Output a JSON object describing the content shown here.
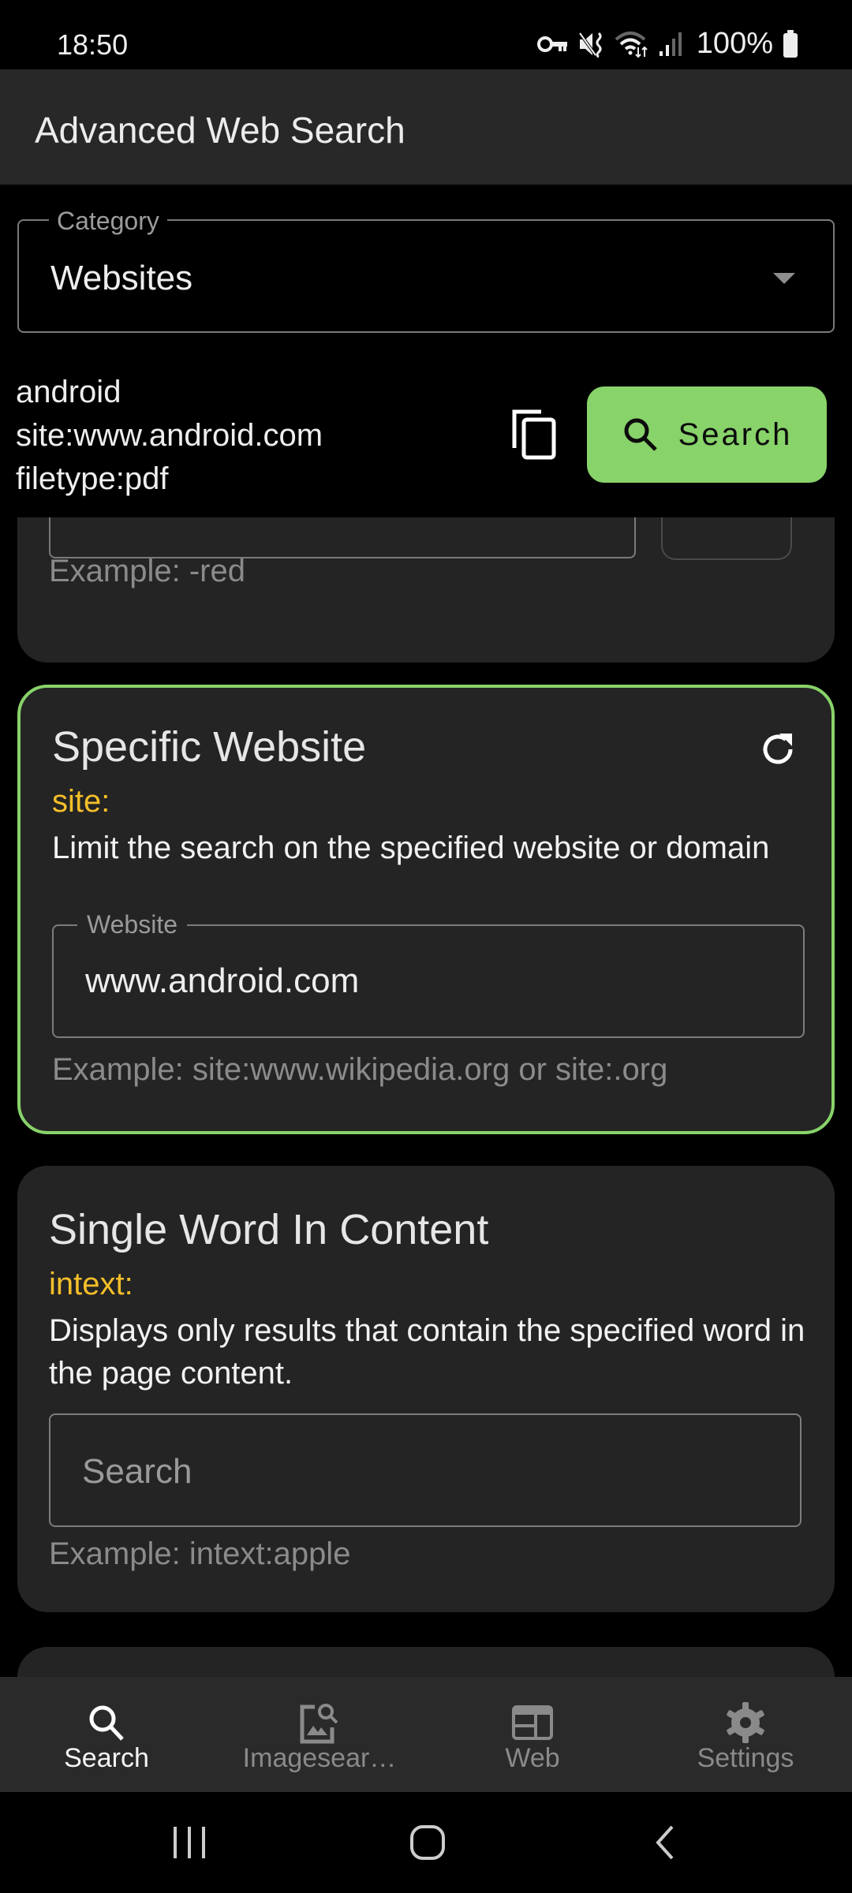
{
  "status_bar": {
    "time": "18:50",
    "battery": "100%",
    "icons": [
      "vpn-key-icon",
      "mute-vibrate-icon",
      "wifi-icon",
      "signal-icon",
      "battery-icon"
    ]
  },
  "app_bar": {
    "title": "Advanced Web Search"
  },
  "category": {
    "label": "Category",
    "value": "Websites"
  },
  "query": {
    "text": "android\nsite:www.android.com\nfiletype:pdf",
    "copy_icon": "copy-icon",
    "search_label": "Search"
  },
  "cards": [
    {
      "example": "Example: -red"
    },
    {
      "title": "Specific Website",
      "operator": "site:",
      "description": "Limit the search on the specified website or domain",
      "field_label": "Website",
      "field_value": "www.android.com",
      "example": "Example: site:www.wikipedia.org or site:.org",
      "active": true
    },
    {
      "title": "Single Word In Content",
      "operator": "intext:",
      "description": "Displays only results that contain the specified word in the page content.",
      "field_placeholder": "Search",
      "field_value": "",
      "example": "Example: intext:apple"
    }
  ],
  "bottom_nav": [
    {
      "label": "Search",
      "icon": "search-icon",
      "active": true
    },
    {
      "label": "Imagesear…",
      "icon": "image-search-icon",
      "active": false
    },
    {
      "label": "Web",
      "icon": "web-icon",
      "active": false
    },
    {
      "label": "Settings",
      "icon": "gear-icon",
      "active": false
    }
  ],
  "colors": {
    "accent": "#88d36a",
    "operator": "#f5bf2a",
    "card_bg": "#242424",
    "appbar_bg": "#282828"
  }
}
